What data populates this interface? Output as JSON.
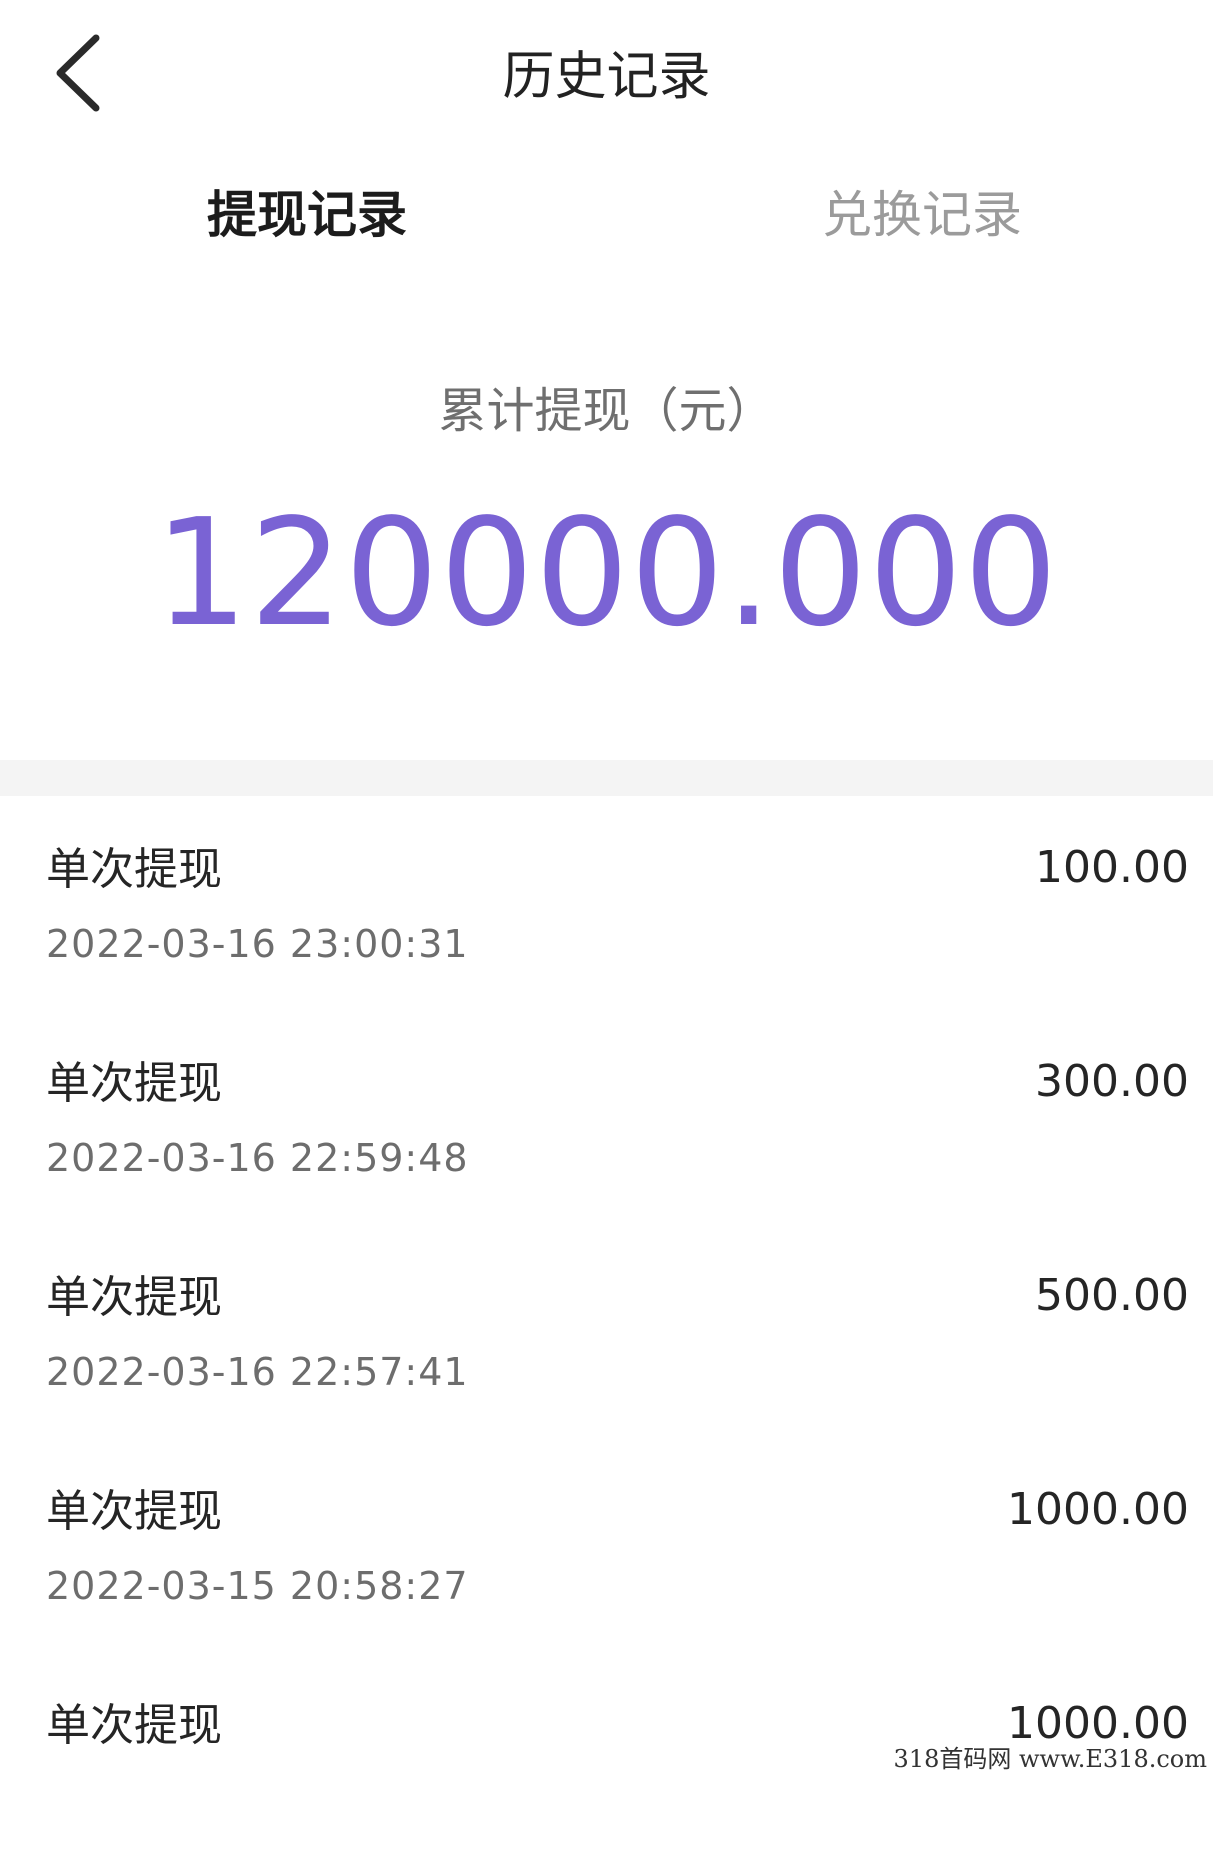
{
  "header": {
    "title": "历史记录",
    "back_icon": "chevron-left-icon"
  },
  "tabs": [
    {
      "label": "提现记录",
      "active": true
    },
    {
      "label": "兑换记录",
      "active": false
    }
  ],
  "summary": {
    "label": "累计提现（元）",
    "amount": "120000.000",
    "accent_color": "#7a63d4"
  },
  "records": [
    {
      "title": "单次提现",
      "time": "2022-03-16 23:00:31",
      "amount": "100.00"
    },
    {
      "title": "单次提现",
      "time": "2022-03-16 22:59:48",
      "amount": "300.00"
    },
    {
      "title": "单次提现",
      "time": "2022-03-16 22:57:41",
      "amount": "500.00"
    },
    {
      "title": "单次提现",
      "time": "2022-03-15 20:58:27",
      "amount": "1000.00"
    },
    {
      "title": "单次提现",
      "time": "",
      "amount": "1000.00"
    }
  ],
  "watermark": "318首码网  www.E318.com"
}
